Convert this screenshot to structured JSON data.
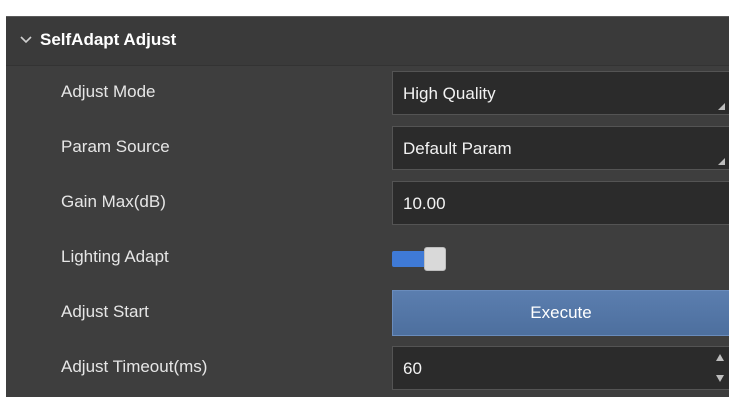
{
  "section": {
    "title": "SelfAdapt Adjust"
  },
  "rows": {
    "adjust_mode": {
      "label": "Adjust Mode",
      "value": "High Quality"
    },
    "param_source": {
      "label": "Param Source",
      "value": "Default Param"
    },
    "gain_max": {
      "label": "Gain Max(dB)",
      "value": "10.00"
    },
    "lighting_adapt": {
      "label": "Lighting Adapt",
      "enabled": true
    },
    "adjust_start": {
      "label": "Adjust Start",
      "button_label": "Execute"
    },
    "adjust_timeout": {
      "label": "Adjust Timeout(ms)",
      "value": "60"
    }
  },
  "colors": {
    "panel_bg": "#3e3e3e",
    "field_bg": "#2b2b2b",
    "toggle_on": "#3f7ad6",
    "button_bg": "#5276a6"
  },
  "icons": {
    "section_toggle": "chevron-down-icon",
    "dropdown_grip": "corner-grip-icon",
    "spinner": "spinner-arrows-icon"
  }
}
